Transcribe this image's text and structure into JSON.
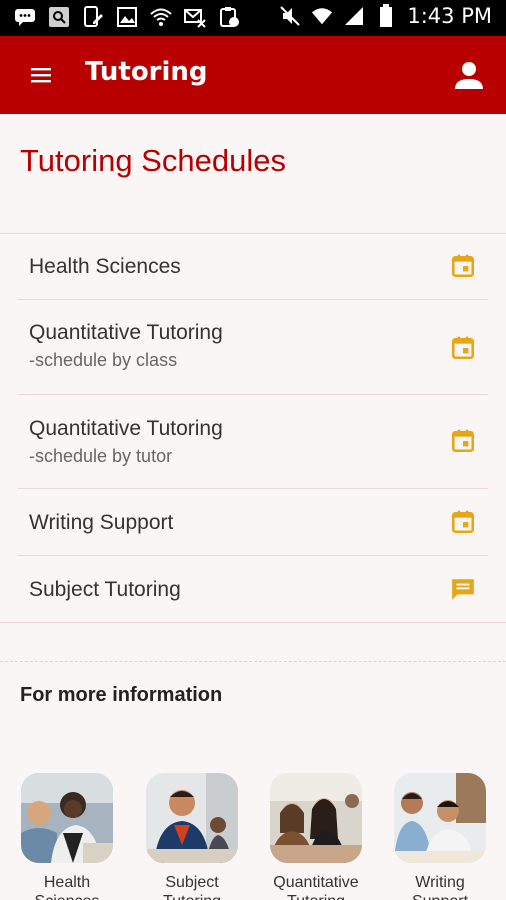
{
  "status_bar": {
    "time": "1:43 PM",
    "left_icons": [
      "message-icon",
      "search-icon",
      "phone-edit-icon",
      "image-icon",
      "wifi-icon",
      "mail-x-icon",
      "clipboard-icon"
    ],
    "right_icons": [
      "mute-icon",
      "wifi-signal-icon",
      "cell-signal-icon",
      "battery-icon"
    ]
  },
  "app_bar": {
    "title": "Tutoring",
    "background": "#b80000"
  },
  "page": {
    "title": "Tutoring Schedules",
    "accent": "#b80000",
    "icon_color": "#e6a617"
  },
  "schedules": [
    {
      "label": "Health Sciences",
      "sub": "",
      "icon": "calendar-icon"
    },
    {
      "label": "Quantitative Tutoring",
      "sub": "-schedule by class",
      "icon": "calendar-icon"
    },
    {
      "label": "Quantitative Tutoring",
      "sub": "-schedule by tutor",
      "icon": "calendar-icon"
    },
    {
      "label": "Writing Support",
      "sub": "",
      "icon": "calendar-icon"
    },
    {
      "label": "Subject Tutoring",
      "sub": "",
      "icon": "chat-icon"
    }
  ],
  "more_info": {
    "heading": "For more information",
    "tiles": [
      {
        "label": "Health Sciences"
      },
      {
        "label": "Subject Tutoring"
      },
      {
        "label": "Quantitative Tutoring"
      },
      {
        "label": "Writing Support"
      }
    ]
  }
}
